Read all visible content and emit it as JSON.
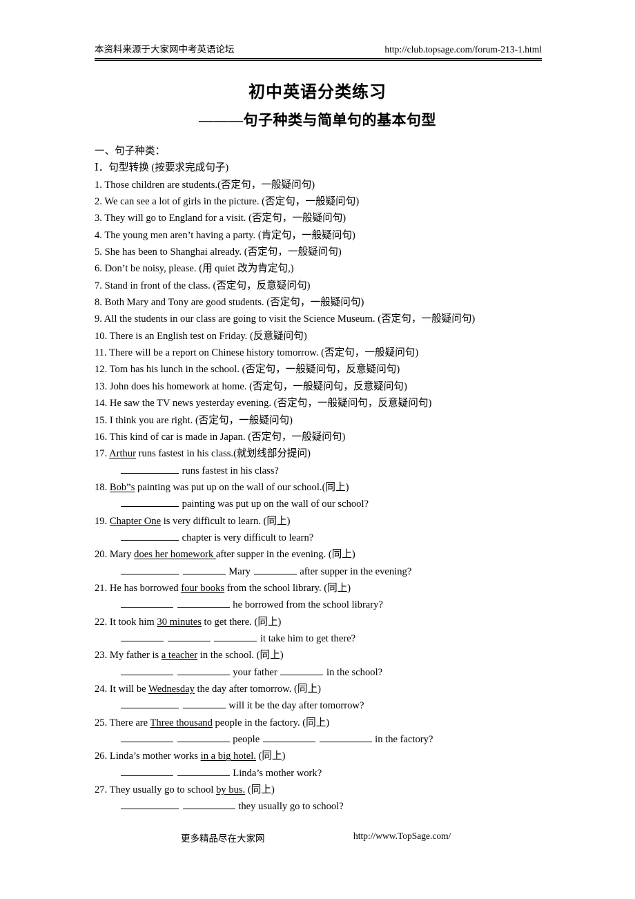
{
  "header": {
    "left_text": "本资料来源于大家网中考英语论坛",
    "right_url": "http://club.topsage.com/forum-213-1.html"
  },
  "title": "初中英语分类练习",
  "subtitle": "———句子种类与简单句的基本句型",
  "sections": {
    "section_one": "一、句子种类：",
    "part_one": "Ⅰ．句型转换 (按要求完成句子)"
  },
  "items": [
    {
      "num": "1.",
      "pre": "Those children are students.",
      "tag": "(否定句，一般疑问句)"
    },
    {
      "num": "2.",
      "pre": "We can see a lot of girls in the picture. ",
      "tag": "(否定句，一般疑问句)"
    },
    {
      "num": "3.",
      "pre": "They will go to England for a visit. ",
      "tag": "(否定句，一般疑问句)"
    },
    {
      "num": "4.",
      "pre": "The young men aren’t having a party. ",
      "tag": "(肯定句，一般疑问句)"
    },
    {
      "num": "5.",
      "pre": "She has been to Shanghai already. ",
      "tag": "(否定句，一般疑问句)"
    },
    {
      "num": "6.",
      "pre": "Don’t be noisy, please. ",
      "tag": "(用 quiet 改为肯定句,)"
    },
    {
      "num": "7.",
      "pre": "Stand in front of the class. ",
      "tag": "(否定句，反意疑问句)"
    },
    {
      "num": "8.",
      "pre": "Both Mary and Tony are good students. ",
      "tag": "(否定句，一般疑问句)"
    },
    {
      "num": "9.",
      "pre": "All the students in our class are going to visit the Science Museum. ",
      "tag": "(否定句，一般疑问句)"
    },
    {
      "num": "10.",
      "pre": "There is an English test on Friday. ",
      "tag": "(反意疑问句)"
    },
    {
      "num": "11.",
      "pre": "There will be a report on Chinese history tomorrow. ",
      "tag": "(否定句，一般疑问句)"
    },
    {
      "num": "12.",
      "pre": "Tom has his lunch in the school. ",
      "tag": "(否定句，一般疑问句，反意疑问句)"
    },
    {
      "num": "13.",
      "pre": "John does his homework at home. ",
      "tag": "(否定句，一般疑问句，反意疑问句)"
    },
    {
      "num": "14.",
      "pre": "He saw the TV news yesterday evening. ",
      "tag": "(否定句，一般疑问句，反意疑问句)"
    },
    {
      "num": "15.",
      "pre": "I think you are right. ",
      "tag": "(否定句，一般疑问句)"
    },
    {
      "num": "16.",
      "pre": "This kind of car is made in Japan. ",
      "tag": "(否定句，一般疑问句)"
    }
  ],
  "transform_items": [
    {
      "num": "17.",
      "pre": "",
      "underlined": "Arthur",
      "post": " runs fastest in his class.",
      "tag": "(就划线部分提问)",
      "answer_tail": " runs fastest in his class?"
    },
    {
      "num": "18.",
      "pre": "",
      "underlined": "Bob”s",
      "post": " painting was put up on the wall of our school.",
      "tag": "(同上)",
      "answer_tail": " painting was put up on the wall of our school?"
    },
    {
      "num": "19.",
      "pre": "",
      "underlined": "Chapter One",
      "post": " is very difficult to learn. ",
      "tag": "(同上)",
      "answer_tail": " chapter is very difficult to learn?"
    },
    {
      "num": "20.",
      "pre": "Mary ",
      "underlined": "does her homework ",
      "post": "  after supper in the evening. ",
      "tag": "(同上)",
      "answer_mid": " Mary ",
      "answer_tail": " after supper in the evening?"
    },
    {
      "num": "21.",
      "pre": "He has borrowed ",
      "underlined": "four books",
      "post": " from the school library. ",
      "tag": "(同上)",
      "answer_tail": " he borrowed from the school library?"
    },
    {
      "num": "22.",
      "pre": "It took him ",
      "underlined": "30 minutes",
      "post": " to get there. ",
      "tag": "(同上)",
      "answer_tail": " it take him to get there?"
    },
    {
      "num": "23.",
      "pre": "My father is ",
      "underlined": "a teacher",
      "post": " in the school. ",
      "tag": "(同上)",
      "answer_mid": " your father ",
      "answer_tail": " in the school?"
    },
    {
      "num": "24.",
      "pre": "It will be ",
      "underlined": "Wednesday",
      "post": " the day after tomorrow. ",
      "tag": "(同上)",
      "answer_tail": " will it be the day after tomorrow?"
    },
    {
      "num": "25.",
      "pre": "There are ",
      "underlined": "Three thousand",
      "post": " people in the factory. ",
      "tag": "(同上)",
      "answer_mid": " people ",
      "answer_tail": " in the factory?"
    },
    {
      "num": "26.",
      "pre": "Linda’s mother works ",
      "underlined": "in a big hotel.",
      "post": " ",
      "tag": "(同上)",
      "answer_tail": " Linda’s mother work?"
    },
    {
      "num": "27.",
      "pre": "They usually go to school ",
      "underlined": "by bus.",
      "post": " ",
      "tag": "(同上)",
      "answer_tail": " they usually go to school?"
    }
  ],
  "footer": {
    "cn_text": "更多精品尽在大家网",
    "url": "http://www.TopSage.com/"
  }
}
